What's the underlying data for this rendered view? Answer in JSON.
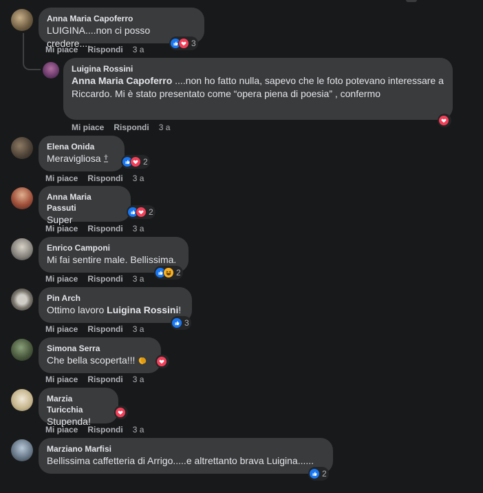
{
  "actions": {
    "like": "Mi piace",
    "reply": "Rispondi"
  },
  "colors": {
    "like": "#1877f2",
    "love": "#f33e58",
    "haha": "#f7b125",
    "bubble": "#3a3b3c",
    "background": "#18191a"
  },
  "comments": [
    {
      "author": "Anna Maria Capoferro",
      "text": "LUIGINA....non ci posso credere....",
      "time": "3 a",
      "reactions": [
        "like",
        "love"
      ],
      "reaction_count": "3"
    },
    {
      "author": "Luigina Rossini",
      "mention": "Anna Maria Capoferro",
      "text": "....non ho fatto nulla, sapevo che le foto potevano interessare a Riccardo. Mi è stato presentato come “opera piena di poesia” , confermo",
      "time": "3 a",
      "reactions": [
        "love"
      ],
      "reaction_count": ""
    },
    {
      "author": "Elena Onida",
      "text": "Meravigliosa",
      "emoji": "thumbs-up-top-icon",
      "time": "3 a",
      "reactions": [
        "like",
        "love"
      ],
      "reaction_count": "2"
    },
    {
      "author": "Anna Maria Passuti",
      "text": "Super",
      "time": "3 a",
      "reactions": [
        "like",
        "love"
      ],
      "reaction_count": "2"
    },
    {
      "author": "Enrico Camponi",
      "text": "Mi fai sentire male. Bellissima.",
      "time": "3 a",
      "reactions": [
        "like",
        "haha"
      ],
      "reaction_count": "2"
    },
    {
      "author": "Pin Arch",
      "text": "Ottimo lavoro ",
      "mention": "Luigina Rossini",
      "text_after": "!",
      "time": "3 a",
      "reactions": [
        "like"
      ],
      "reaction_count": "3"
    },
    {
      "author": "Simona Serra",
      "text": "Che bella scoperta!!! ",
      "emoji": "clapping-hands-icon",
      "time": "3 a",
      "reactions": [
        "love"
      ],
      "reaction_count": ""
    },
    {
      "author": "Marzia Turicchia",
      "text": "Stupenda!",
      "time": "3 a",
      "reactions": [
        "love"
      ],
      "reaction_count": ""
    },
    {
      "author": "Marziano Marfisi",
      "text": "Bellissima caffetteria di Arrigo.....e altrettanto brava Luigina......",
      "reactions": [
        "like"
      ],
      "reaction_count": "2"
    }
  ]
}
